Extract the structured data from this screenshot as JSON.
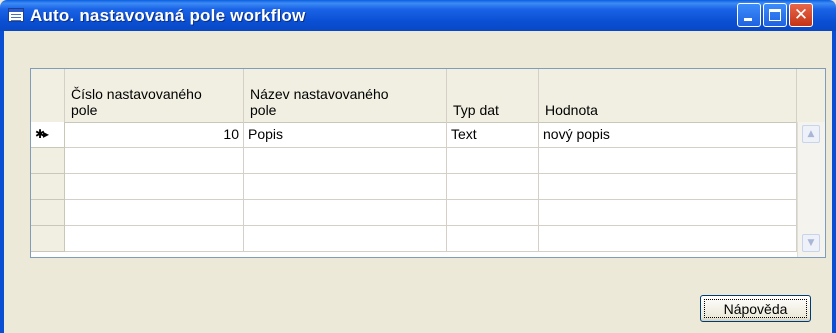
{
  "window": {
    "title": "Auto. nastavovaná pole workflow"
  },
  "grid": {
    "columns": [
      {
        "label_line1": "Číslo nastavovaného",
        "label_line2": "pole"
      },
      {
        "label_line1": "Název nastavovaného",
        "label_line2": "pole"
      },
      {
        "label_line1": "",
        "label_line2": "Typ dat"
      },
      {
        "label_line1": "",
        "label_line2": "Hodnota"
      }
    ],
    "rows": [
      {
        "marker": "✱▸",
        "cells": [
          "10",
          "Popis",
          "Text",
          "nový popis"
        ]
      },
      {
        "marker": "",
        "cells": [
          "",
          "",
          "",
          ""
        ]
      },
      {
        "marker": "",
        "cells": [
          "",
          "",
          "",
          ""
        ]
      },
      {
        "marker": "",
        "cells": [
          "",
          "",
          "",
          ""
        ]
      },
      {
        "marker": "",
        "cells": [
          "",
          "",
          "",
          ""
        ]
      }
    ]
  },
  "buttons": {
    "help_label": "Nápověda"
  },
  "colors": {
    "titlebar": "#0a4fd3",
    "window_bg": "#ece9d8",
    "close_button": "#c43314"
  },
  "icons": [
    "form-icon",
    "minimize-icon",
    "maximize-icon",
    "close-icon",
    "scroll-up-icon",
    "scroll-down-icon",
    "new-record-icon"
  ]
}
